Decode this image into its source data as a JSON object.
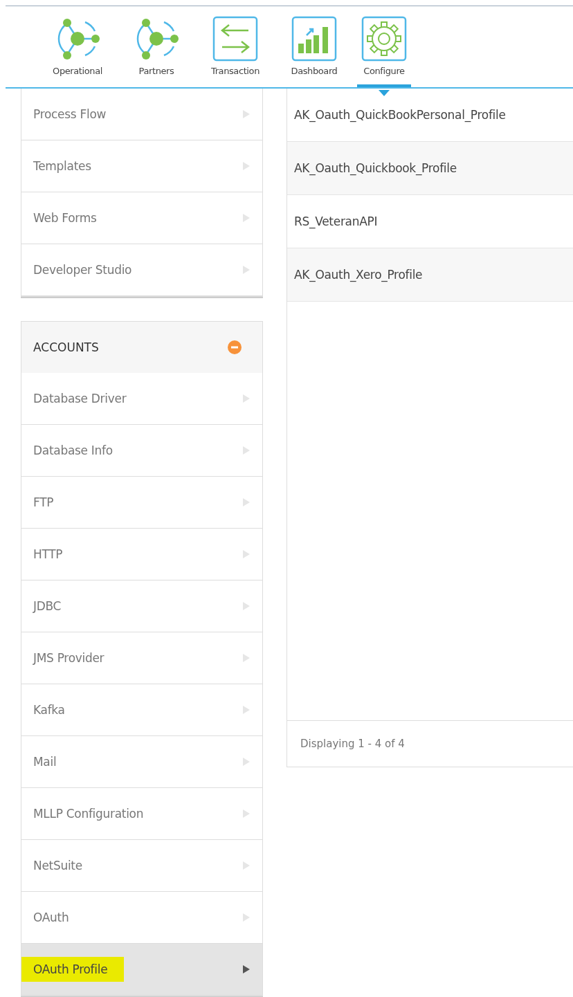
{
  "nav": [
    {
      "label": "Operational",
      "kind": "network",
      "selected": false
    },
    {
      "label": "Partners",
      "kind": "network",
      "selected": false
    },
    {
      "label": "Transaction",
      "kind": "transfer",
      "selected": false
    },
    {
      "label": "Dashboard",
      "kind": "chart",
      "selected": false
    },
    {
      "label": "Configure",
      "kind": "gear",
      "selected": true
    }
  ],
  "sidebar": {
    "groups": [
      {
        "items": [
          {
            "label": "Process Flow",
            "selected": false
          },
          {
            "label": "Templates",
            "selected": false
          },
          {
            "label": "Web Forms",
            "selected": false
          },
          {
            "label": "Developer Studio",
            "selected": false
          }
        ]
      },
      {
        "title": "ACCOUNTS",
        "expanded": true,
        "items": [
          {
            "label": "Database Driver",
            "selected": false
          },
          {
            "label": "Database Info",
            "selected": false
          },
          {
            "label": "FTP",
            "selected": false
          },
          {
            "label": "HTTP",
            "selected": false
          },
          {
            "label": "JDBC",
            "selected": false
          },
          {
            "label": "JMS Provider",
            "selected": false
          },
          {
            "label": "Kafka",
            "selected": false
          },
          {
            "label": "Mail",
            "selected": false
          },
          {
            "label": "MLLP Configuration",
            "selected": false
          },
          {
            "label": "NetSuite",
            "selected": false
          },
          {
            "label": "OAuth",
            "selected": false
          },
          {
            "label": "OAuth Profile",
            "selected": true,
            "highlighted": true
          }
        ]
      }
    ]
  },
  "list": {
    "rows": [
      "AK_Oauth_QuickBookPersonal_Profile",
      "AK_Oauth_Quickbook_Profile",
      "RS_VeteranAPI",
      "AK_Oauth_Xero_Profile"
    ],
    "footer": "Displaying 1 - 4 of 4"
  }
}
